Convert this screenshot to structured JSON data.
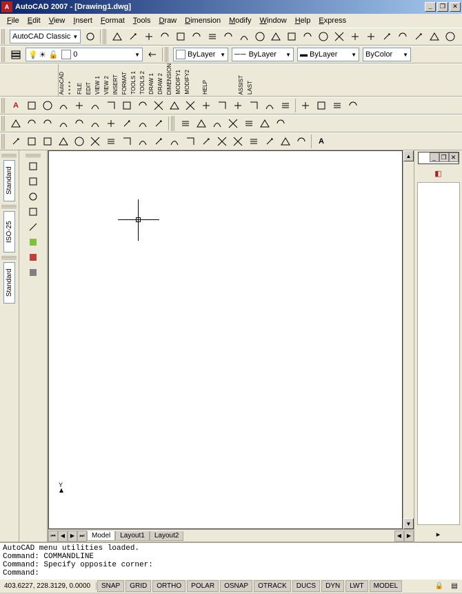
{
  "title": "AutoCAD 2007 - [Drawing1.dwg]",
  "window_buttons": {
    "min": "_",
    "max": "❐",
    "close": "✕"
  },
  "menu": [
    "File",
    "Edit",
    "View",
    "Insert",
    "Format",
    "Tools",
    "Draw",
    "Dimension",
    "Modify",
    "Window",
    "Help",
    "Express"
  ],
  "workspace_combo": "AutoCAD Classic",
  "layer_row": {
    "layer_combo": "0",
    "color_combo": "ByLayer",
    "linetype_combo": "ByLayer",
    "lineweight_combo": "ByLayer",
    "plot_combo": "ByColor"
  },
  "standard_icons": [
    "new-icon",
    "open-icon",
    "save-icon",
    "plot-icon",
    "plot-preview-icon",
    "publish-icon",
    "cut-icon",
    "copy-icon",
    "paste-icon",
    "match-properties-icon",
    "undo-icon",
    "redo-icon",
    "pan-icon",
    "zoom-realtime-icon",
    "zoom-window-icon",
    "zoom-previous-icon",
    "properties-icon",
    "design-center-icon",
    "tool-palettes-icon",
    "sheet-set-icon",
    "markup-icon",
    "block-editor-icon",
    "clean-screen-icon",
    "help-icon"
  ],
  "rotated_menu_list": [
    "AutoCAD",
    "* * * *",
    "FILE",
    "EDIT",
    "VIEW 1",
    "VIEW 2",
    "INSERT",
    "FORMAT",
    "TOOLS 1",
    "TOOLS 2",
    "DRAW 1",
    "DRAW 2",
    "DIMENSION",
    "MODIFY1",
    "MODIFY2",
    "",
    "HELP",
    "",
    "",
    "",
    "ASSIST",
    "LAST"
  ],
  "draw_icons": [
    "line-icon",
    "construction-line-icon",
    "polyline-icon",
    "polygon-icon",
    "rectangle-icon",
    "arc-icon",
    "circle-icon",
    "revision-cloud-icon",
    "spline-icon",
    "ellipse-icon",
    "ellipse-arc-icon",
    "insert-block-icon",
    "make-block-icon",
    "point-icon",
    "hatch-icon",
    "gradient-icon",
    "region-icon",
    "table-icon",
    "multiline-text-icon"
  ],
  "modify_icons": [
    "erase-icon",
    "copy-icon",
    "mirror-icon",
    "offset-icon",
    "array-icon",
    "move-icon",
    "rotate-icon",
    "scale-icon",
    "stretch-icon",
    "trim-icon",
    "extend-icon",
    "break-at-point-icon",
    "break-icon",
    "join-icon",
    "chamfer-icon",
    "fillet-icon",
    "explode-icon"
  ],
  "dim_icons": [
    "dim-linear-icon",
    "dim-aligned-icon",
    "dim-arc-icon",
    "dim-ordinate-icon",
    "dim-radius-icon",
    "dim-jogged-icon",
    "dim-diameter-icon",
    "dim-angular-icon",
    "dim-quick-icon",
    "dim-baseline-icon",
    "dim-continue-icon",
    "quick-leader-icon",
    "tolerance-icon",
    "center-mark-icon",
    "dim-edit-icon",
    "dim-tedit-icon",
    "dim-update-icon"
  ],
  "styles_row2": [
    "text-style-icon",
    "dim-style-icon",
    "table-style-icon",
    "mline-style-icon"
  ],
  "left_dock_a": {
    "items": [
      "Standard",
      "ISO-25",
      "Standard"
    ]
  },
  "tabs": {
    "model": "Model",
    "layout1": "Layout1",
    "layout2": "Layout2"
  },
  "command_window": {
    "line1": "AutoCAD menu utilities loaded.",
    "line2": "Command: COMMANDLINE",
    "line3": "Command: Specify opposite corner:",
    "prompt": "Command:"
  },
  "status": {
    "coords": "403.6227, 228.3129, 0.0000",
    "toggles": [
      "SNAP",
      "GRID",
      "ORTHO",
      "POLAR",
      "OSNAP",
      "OTRACK",
      "DUCS",
      "DYN",
      "LWT",
      "MODEL"
    ]
  }
}
